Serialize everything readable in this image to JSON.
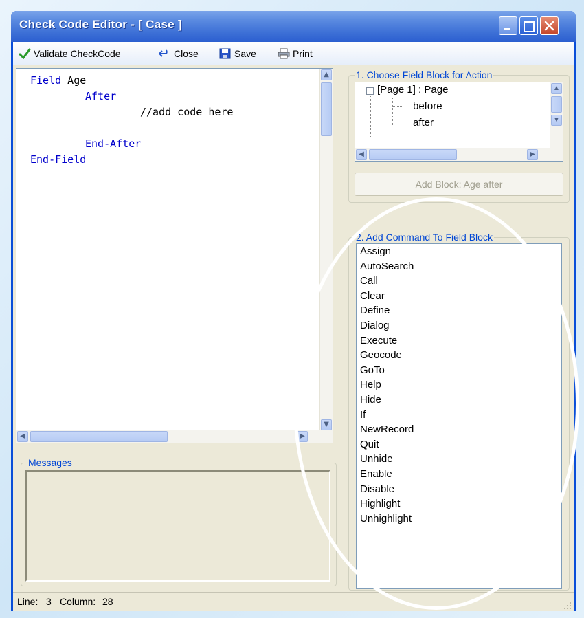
{
  "window": {
    "title": "Check Code Editor - [ Case ]"
  },
  "toolbar": {
    "validate_label": "Validate CheckCode",
    "close_label": "Close",
    "save_label": "Save",
    "print_label": "Print"
  },
  "editor": {
    "lines": [
      {
        "keyword": "Field",
        "text": " Age"
      },
      {
        "keyword": "After",
        "text": ""
      },
      {
        "keyword": "",
        "text": "//add code here"
      },
      {
        "keyword": "",
        "text": ""
      },
      {
        "keyword": "End-After",
        "text": ""
      },
      {
        "keyword": "End-Field",
        "text": ""
      }
    ]
  },
  "messages": {
    "label": "Messages"
  },
  "field_block": {
    "label": "1. Choose Field Block for Action",
    "tree": {
      "root": "[Page 1] : Page",
      "children": [
        "before",
        "after"
      ]
    },
    "add_block_label": "Add Block: Age after"
  },
  "commands": {
    "label": "2. Add Command To Field Block",
    "items": [
      "Assign",
      "AutoSearch",
      "Call",
      "Clear",
      "Define",
      "Dialog",
      "Execute",
      "Geocode",
      "GoTo",
      "Help",
      "Hide",
      "If",
      "NewRecord",
      "Quit",
      "Unhide",
      "Enable",
      "Disable",
      "Highlight",
      "Unhighlight"
    ]
  },
  "status": {
    "line_label": "Line:",
    "line_value": "3",
    "column_label": "Column:",
    "column_value": "28"
  },
  "colors": {
    "keyword": "#0000cc",
    "group_label": "#0046d5",
    "titlebar": "#2c5fd0"
  }
}
